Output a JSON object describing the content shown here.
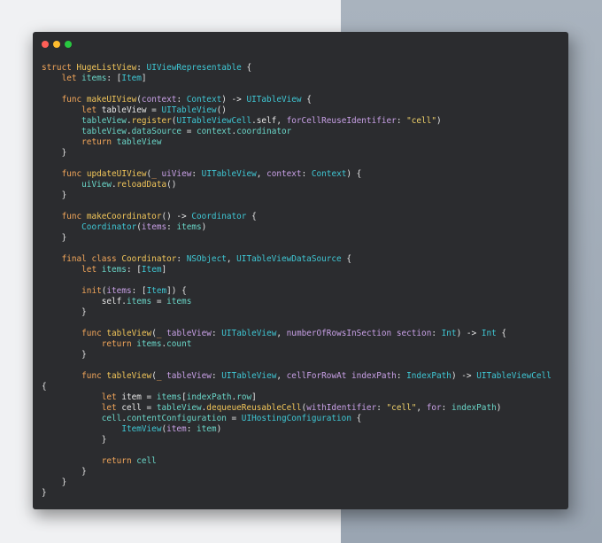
{
  "window": {
    "traffic_lights": [
      {
        "name": "close",
        "color": "#ff5f57"
      },
      {
        "name": "minimize",
        "color": "#febc2e"
      },
      {
        "name": "zoom",
        "color": "#28c840"
      }
    ]
  },
  "code": {
    "lines": [
      [
        [
          "keyword",
          "struct "
        ],
        [
          "func",
          "HugeListView"
        ],
        [
          "plain",
          ": "
        ],
        [
          "type",
          "UIViewRepresentable"
        ],
        [
          "plain",
          " {"
        ]
      ],
      [
        [
          "plain",
          "    "
        ],
        [
          "keyword",
          "let "
        ],
        [
          "prop",
          "items"
        ],
        [
          "plain",
          ": ["
        ],
        [
          "type",
          "Item"
        ],
        [
          "plain",
          "]"
        ]
      ],
      [],
      [
        [
          "plain",
          "    "
        ],
        [
          "keyword",
          "func "
        ],
        [
          "func",
          "makeUIView"
        ],
        [
          "plain",
          "("
        ],
        [
          "param",
          "context"
        ],
        [
          "plain",
          ": "
        ],
        [
          "type",
          "Context"
        ],
        [
          "plain",
          ") -> "
        ],
        [
          "type",
          "UITableView"
        ],
        [
          "plain",
          " {"
        ]
      ],
      [
        [
          "plain",
          "        "
        ],
        [
          "keyword",
          "let "
        ],
        [
          "plain",
          "tableView = "
        ],
        [
          "type",
          "UITableView"
        ],
        [
          "plain",
          "()"
        ]
      ],
      [
        [
          "plain",
          "        "
        ],
        [
          "prop",
          "tableView"
        ],
        [
          "plain",
          "."
        ],
        [
          "func",
          "register"
        ],
        [
          "plain",
          "("
        ],
        [
          "type",
          "UITableViewCell"
        ],
        [
          "plain",
          ".self, "
        ],
        [
          "param",
          "forCellReuseIdentifier"
        ],
        [
          "plain",
          ": "
        ],
        [
          "string",
          "\"cell\""
        ],
        [
          "plain",
          ")"
        ]
      ],
      [
        [
          "plain",
          "        "
        ],
        [
          "prop",
          "tableView"
        ],
        [
          "plain",
          "."
        ],
        [
          "prop",
          "dataSource"
        ],
        [
          "plain",
          " = "
        ],
        [
          "prop",
          "context"
        ],
        [
          "plain",
          "."
        ],
        [
          "prop",
          "coordinator"
        ]
      ],
      [
        [
          "plain",
          "        "
        ],
        [
          "keyword",
          "return "
        ],
        [
          "prop",
          "tableView"
        ]
      ],
      [
        [
          "plain",
          "    }"
        ]
      ],
      [],
      [
        [
          "plain",
          "    "
        ],
        [
          "keyword",
          "func "
        ],
        [
          "func",
          "updateUIView"
        ],
        [
          "plain",
          "("
        ],
        [
          "keyword",
          "_ "
        ],
        [
          "param",
          "uiView"
        ],
        [
          "plain",
          ": "
        ],
        [
          "type",
          "UITableView"
        ],
        [
          "plain",
          ", "
        ],
        [
          "param",
          "context"
        ],
        [
          "plain",
          ": "
        ],
        [
          "type",
          "Context"
        ],
        [
          "plain",
          ") {"
        ]
      ],
      [
        [
          "plain",
          "        "
        ],
        [
          "prop",
          "uiView"
        ],
        [
          "plain",
          "."
        ],
        [
          "func",
          "reloadData"
        ],
        [
          "plain",
          "()"
        ]
      ],
      [
        [
          "plain",
          "    }"
        ]
      ],
      [],
      [
        [
          "plain",
          "    "
        ],
        [
          "keyword",
          "func "
        ],
        [
          "func",
          "makeCoordinator"
        ],
        [
          "plain",
          "() -> "
        ],
        [
          "type",
          "Coordinator"
        ],
        [
          "plain",
          " {"
        ]
      ],
      [
        [
          "plain",
          "        "
        ],
        [
          "type",
          "Coordinator"
        ],
        [
          "plain",
          "("
        ],
        [
          "param",
          "items"
        ],
        [
          "plain",
          ": "
        ],
        [
          "prop",
          "items"
        ],
        [
          "plain",
          ")"
        ]
      ],
      [
        [
          "plain",
          "    }"
        ]
      ],
      [],
      [
        [
          "plain",
          "    "
        ],
        [
          "keyword",
          "final class "
        ],
        [
          "func",
          "Coordinator"
        ],
        [
          "plain",
          ": "
        ],
        [
          "type",
          "NSObject"
        ],
        [
          "plain",
          ", "
        ],
        [
          "type",
          "UITableViewDataSource"
        ],
        [
          "plain",
          " {"
        ]
      ],
      [
        [
          "plain",
          "        "
        ],
        [
          "keyword",
          "let "
        ],
        [
          "prop",
          "items"
        ],
        [
          "plain",
          ": ["
        ],
        [
          "type",
          "Item"
        ],
        [
          "plain",
          "]"
        ]
      ],
      [],
      [
        [
          "plain",
          "        "
        ],
        [
          "keyword",
          "init"
        ],
        [
          "plain",
          "("
        ],
        [
          "param",
          "items"
        ],
        [
          "plain",
          ": ["
        ],
        [
          "type",
          "Item"
        ],
        [
          "plain",
          "]) {"
        ]
      ],
      [
        [
          "plain",
          "            self."
        ],
        [
          "prop",
          "items"
        ],
        [
          "plain",
          " = "
        ],
        [
          "prop",
          "items"
        ]
      ],
      [
        [
          "plain",
          "        }"
        ]
      ],
      [],
      [
        [
          "plain",
          "        "
        ],
        [
          "keyword",
          "func "
        ],
        [
          "func",
          "tableView"
        ],
        [
          "plain",
          "("
        ],
        [
          "keyword",
          "_ "
        ],
        [
          "param",
          "tableView"
        ],
        [
          "plain",
          ": "
        ],
        [
          "type",
          "UITableView"
        ],
        [
          "plain",
          ", "
        ],
        [
          "param",
          "numberOfRowsInSection section"
        ],
        [
          "plain",
          ": "
        ],
        [
          "type",
          "Int"
        ],
        [
          "plain",
          ") -> "
        ],
        [
          "type",
          "Int"
        ],
        [
          "plain",
          " {"
        ]
      ],
      [
        [
          "plain",
          "            "
        ],
        [
          "keyword",
          "return "
        ],
        [
          "prop",
          "items"
        ],
        [
          "plain",
          "."
        ],
        [
          "prop",
          "count"
        ]
      ],
      [
        [
          "plain",
          "        }"
        ]
      ],
      [],
      [
        [
          "plain",
          "        "
        ],
        [
          "keyword",
          "func "
        ],
        [
          "func",
          "tableView"
        ],
        [
          "plain",
          "("
        ],
        [
          "keyword",
          "_ "
        ],
        [
          "param",
          "tableView"
        ],
        [
          "plain",
          ": "
        ],
        [
          "type",
          "UITableView"
        ],
        [
          "plain",
          ", "
        ],
        [
          "param",
          "cellForRowAt indexPath"
        ],
        [
          "plain",
          ": "
        ],
        [
          "type",
          "IndexPath"
        ],
        [
          "plain",
          ") -> "
        ],
        [
          "type",
          "UITableViewCell"
        ]
      ],
      [
        [
          "plain",
          "{"
        ]
      ],
      [
        [
          "plain",
          "            "
        ],
        [
          "keyword",
          "let "
        ],
        [
          "plain",
          "item = "
        ],
        [
          "prop",
          "items"
        ],
        [
          "plain",
          "["
        ],
        [
          "prop",
          "indexPath"
        ],
        [
          "plain",
          "."
        ],
        [
          "prop",
          "row"
        ],
        [
          "plain",
          "]"
        ]
      ],
      [
        [
          "plain",
          "            "
        ],
        [
          "keyword",
          "let "
        ],
        [
          "plain",
          "cell = "
        ],
        [
          "prop",
          "tableView"
        ],
        [
          "plain",
          "."
        ],
        [
          "func",
          "dequeueReusableCell"
        ],
        [
          "plain",
          "("
        ],
        [
          "param",
          "withIdentifier"
        ],
        [
          "plain",
          ": "
        ],
        [
          "string",
          "\"cell\""
        ],
        [
          "plain",
          ", "
        ],
        [
          "param",
          "for"
        ],
        [
          "plain",
          ": "
        ],
        [
          "prop",
          "indexPath"
        ],
        [
          "plain",
          ")"
        ]
      ],
      [
        [
          "plain",
          "            "
        ],
        [
          "prop",
          "cell"
        ],
        [
          "plain",
          "."
        ],
        [
          "prop",
          "contentConfiguration"
        ],
        [
          "plain",
          " = "
        ],
        [
          "type",
          "UIHostingConfiguration"
        ],
        [
          "plain",
          " {"
        ]
      ],
      [
        [
          "plain",
          "                "
        ],
        [
          "type",
          "ItemView"
        ],
        [
          "plain",
          "("
        ],
        [
          "param",
          "item"
        ],
        [
          "plain",
          ": "
        ],
        [
          "prop",
          "item"
        ],
        [
          "plain",
          ")"
        ]
      ],
      [
        [
          "plain",
          "            }"
        ]
      ],
      [],
      [
        [
          "plain",
          "            "
        ],
        [
          "keyword",
          "return "
        ],
        [
          "prop",
          "cell"
        ]
      ],
      [
        [
          "plain",
          "        }"
        ]
      ],
      [
        [
          "plain",
          "    }"
        ]
      ],
      [
        [
          "plain",
          "}"
        ]
      ]
    ]
  }
}
